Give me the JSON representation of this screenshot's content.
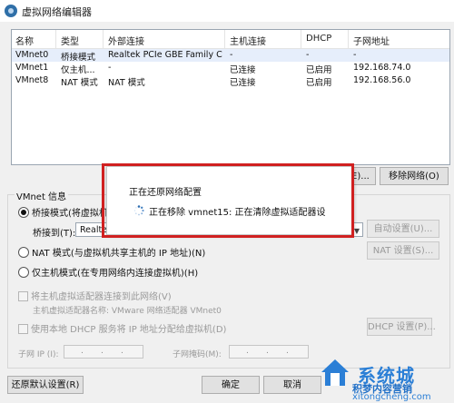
{
  "window": {
    "title": "虚拟网络编辑器"
  },
  "table": {
    "columns": [
      "名称",
      "类型",
      "外部连接",
      "主机连接",
      "DHCP",
      "子网地址"
    ],
    "rows": [
      [
        "VMnet0",
        "桥接模式",
        "Realtek PCIe GBE Family Co...",
        "-",
        "-",
        "-"
      ],
      [
        "VMnet1",
        "仅主机...",
        "-",
        "已连接",
        "已启用",
        "192.168.74.0"
      ],
      [
        "VMnet8",
        "NAT 模式",
        "NAT 模式",
        "已连接",
        "已启用",
        "192.168.56.0"
      ]
    ]
  },
  "buttons": {
    "add_network": "添加网络(E)...",
    "remove_network": "移除网络(O)",
    "auto_settings": "自动设置(U)...",
    "nat_settings": "NAT 设置(S)...",
    "dhcp_settings": "DHCP 设置(P)...",
    "restore_defaults": "还原默认设置(R)",
    "ok": "确定",
    "cancel": "取消"
  },
  "vmnet_info": {
    "label": "VMnet 信息",
    "bridge_option": "桥接模式(将虚拟机直接",
    "bridge_to_label": "桥接到(T):",
    "bridge_to_value": "Realtek PCIe GBE Family Controller",
    "nat_option": "NAT 模式(与虚拟机共享主机的 IP 地址)(N)",
    "hostonly_option": "仅主机模式(在专用网络内连接虚拟机)(H)",
    "connect_adapter": "将主机虚拟适配器连接到此网络(V)",
    "adapter_name": "主机虚拟适配器名称: VMware 网络适配器 VMnet0",
    "use_dhcp": "使用本地 DHCP 服务将 IP 地址分配给虚拟机(D)",
    "subnet_ip_label": "子网 IP (I):",
    "subnet_mask_label": "子网掩码(M):"
  },
  "dialog": {
    "title": "正在还原网络配置",
    "message": "正在移除 vmnet15: 正在清除虚拟适配器设"
  },
  "watermark": {
    "brand": "系统城",
    "line1": "积梦内容营销",
    "line2": "xitongcheng.com"
  },
  "colors": {
    "highlight": "#d02020",
    "selection": "#e6eefb",
    "brand": "#2b7fd6"
  }
}
